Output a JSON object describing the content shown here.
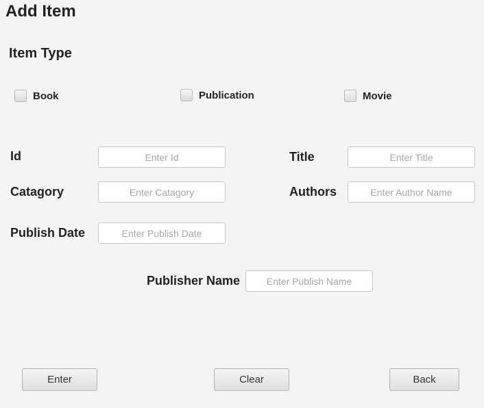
{
  "page": {
    "title": "Add Item",
    "section_title": "Item Type"
  },
  "item_types": [
    {
      "label": "Book",
      "checked": false
    },
    {
      "label": "Publication",
      "checked": false
    },
    {
      "label": "Movie",
      "checked": false
    }
  ],
  "fields": {
    "id": {
      "label": "Id",
      "placeholder": "Enter Id",
      "value": ""
    },
    "title": {
      "label": "Title",
      "placeholder": "Enter Title",
      "value": ""
    },
    "category": {
      "label": "Catagory",
      "placeholder": "Enter Catagory",
      "value": ""
    },
    "authors": {
      "label": "Authors",
      "placeholder": "Enter Author Name",
      "value": ""
    },
    "publish_date": {
      "label": "Publish Date",
      "placeholder": "Enter Publish Date",
      "value": ""
    },
    "publisher_name": {
      "label": "Publisher Name",
      "placeholder": "Enter Publish Name",
      "value": ""
    }
  },
  "buttons": {
    "enter": "Enter",
    "clear": "Clear",
    "back": "Back"
  }
}
